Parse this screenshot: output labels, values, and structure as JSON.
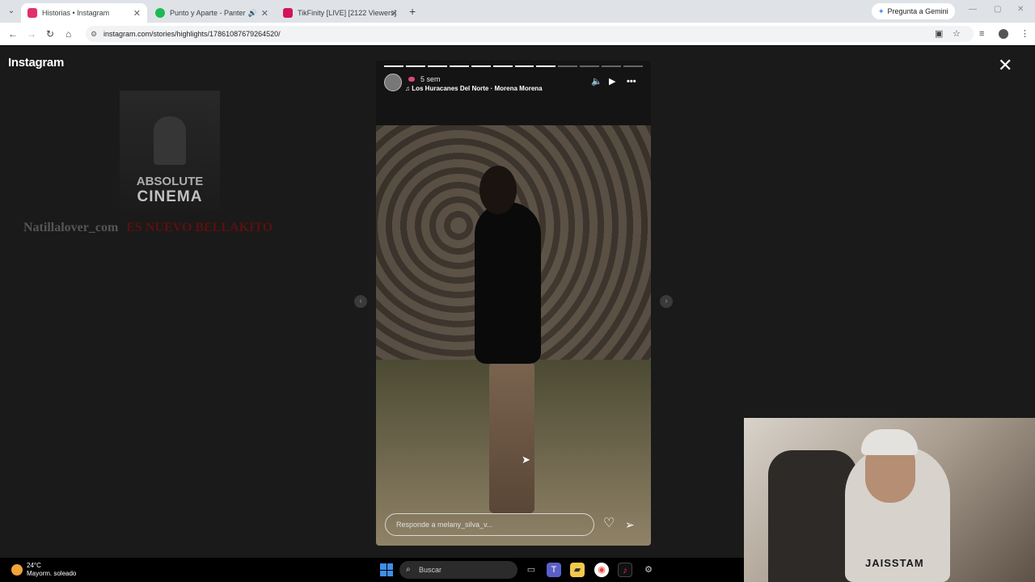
{
  "browser": {
    "tabs": [
      {
        "label": "Historias • Instagram",
        "favicon_color": "#e1306c"
      },
      {
        "label": "Punto y Aparte - Panter Béli",
        "favicon_color": "#1db954"
      },
      {
        "label": "TikFinity [LIVE] [2122 Viewers]",
        "favicon_color": "#d4145a"
      }
    ],
    "gemini_label": "Pregunta a Gemini",
    "url": "instagram.com/stories/highlights/17861087679264520/"
  },
  "instagram": {
    "logo": "Instagram",
    "preview": {
      "title": "ABSOLUTE",
      "subtitle": "CINEMA",
      "caption_name": "Natillalover_com",
      "caption_red": "ES NUEVO BELLAKITO"
    },
    "story": {
      "progress_total": 12,
      "progress_done": 8,
      "time": "5 sem",
      "music": "Los Huracanes Del Norte · Morena Morena",
      "reply_placeholder": "Responde a melany_silva_v..."
    }
  },
  "webcam": {
    "hoodie_print": "JAISSTAM"
  },
  "taskbar": {
    "temperature": "24°C",
    "weather": "Mayorm. soleado",
    "search_placeholder": "Buscar"
  },
  "colors": {
    "page_bg": "#1a1a1a",
    "accent_pink": "#e0457b",
    "tab_bar": "#dfe3e8"
  },
  "icons": [
    "tab-menu-icon",
    "close-icon",
    "plus-icon",
    "back-icon",
    "forward-icon",
    "reload-icon",
    "home-icon",
    "site-info-icon",
    "screencast-icon",
    "star-icon",
    "media-icon",
    "profile-icon",
    "kebab-icon",
    "volume-icon",
    "play-icon",
    "more-icon",
    "heart-icon",
    "send-icon",
    "chevron-left-icon",
    "chevron-right-icon",
    "windows-start-icon",
    "search-icon"
  ]
}
